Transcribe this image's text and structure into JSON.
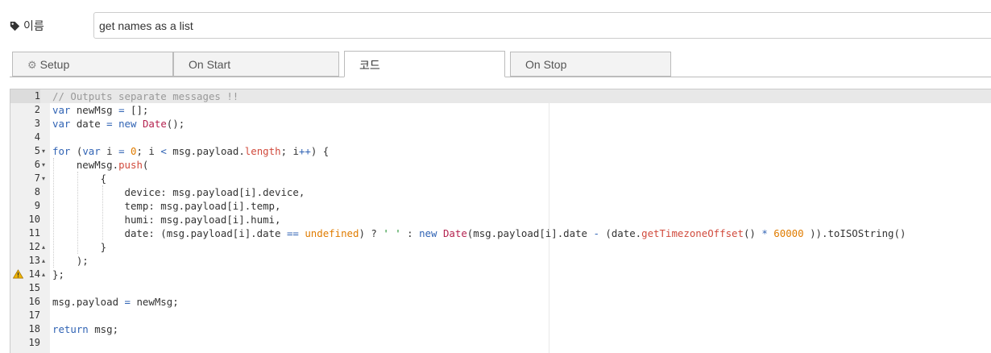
{
  "name_field": {
    "label": "이름",
    "value": "get names as a list"
  },
  "tabs": [
    {
      "label": "Setup",
      "icon": "gear-icon"
    },
    {
      "label": "On Start"
    },
    {
      "label": "코드",
      "active": true
    },
    {
      "label": "On Stop"
    }
  ],
  "editor": {
    "lines": [
      {
        "n": "1",
        "fold": "",
        "warn": false,
        "active": true
      },
      {
        "n": "2",
        "fold": "",
        "warn": false
      },
      {
        "n": "3",
        "fold": "",
        "warn": false
      },
      {
        "n": "4",
        "fold": "",
        "warn": false
      },
      {
        "n": "5",
        "fold": "▾",
        "warn": false
      },
      {
        "n": "6",
        "fold": "▾",
        "warn": false
      },
      {
        "n": "7",
        "fold": "▾",
        "warn": false
      },
      {
        "n": "8",
        "fold": "",
        "warn": false
      },
      {
        "n": "9",
        "fold": "",
        "warn": false
      },
      {
        "n": "10",
        "fold": "",
        "warn": false
      },
      {
        "n": "11",
        "fold": "",
        "warn": false
      },
      {
        "n": "12",
        "fold": "▴",
        "warn": false
      },
      {
        "n": "13",
        "fold": "▴",
        "warn": false
      },
      {
        "n": "14",
        "fold": "▴",
        "warn": true
      },
      {
        "n": "15",
        "fold": "",
        "warn": false
      },
      {
        "n": "16",
        "fold": "",
        "warn": false
      },
      {
        "n": "17",
        "fold": "",
        "warn": false
      },
      {
        "n": "18",
        "fold": "",
        "warn": false
      },
      {
        "n": "19",
        "fold": "",
        "warn": false
      }
    ],
    "code": [
      [
        [
          "cm",
          "// Outputs separate messages !!"
        ]
      ],
      [
        [
          "kw",
          "var"
        ],
        [
          "",
          "",
          " newMsg "
        ],
        [
          "op",
          "="
        ],
        [
          "",
          " [];"
        ]
      ],
      [
        [
          "kw",
          "var"
        ],
        [
          "",
          " date "
        ],
        [
          "op",
          "="
        ],
        [
          "",
          " "
        ],
        [
          "kw",
          "new"
        ],
        [
          "",
          " "
        ],
        [
          "fn",
          "Date"
        ],
        [
          "",
          "();"
        ]
      ],
      [],
      [
        [
          "kw",
          "for"
        ],
        [
          "",
          " ("
        ],
        [
          "kw",
          "var"
        ],
        [
          "",
          " i "
        ],
        [
          "op",
          "="
        ],
        [
          "",
          " "
        ],
        [
          "num",
          "0"
        ],
        [
          "",
          "; i "
        ],
        [
          "op",
          "<"
        ],
        [
          "",
          " msg.payload."
        ],
        [
          "prop",
          "length"
        ],
        [
          "",
          "; i"
        ],
        [
          "op",
          "++"
        ],
        [
          "",
          ") {"
        ]
      ],
      [
        [
          "",
          "    newMsg."
        ],
        [
          "prop",
          "push"
        ],
        [
          "",
          "("
        ]
      ],
      [
        [
          "",
          "        {"
        ]
      ],
      [
        [
          "",
          "            device: msg.payload[i].device,"
        ]
      ],
      [
        [
          "",
          "            temp: msg.payload[i].temp,"
        ]
      ],
      [
        [
          "",
          "            humi: msg.payload[i].humi,"
        ]
      ],
      [
        [
          "",
          "            date: (msg.payload[i].date "
        ],
        [
          "op",
          "=="
        ],
        [
          "",
          " "
        ],
        [
          "und",
          "undefined"
        ],
        [
          "",
          ") ? "
        ],
        [
          "str",
          "' '"
        ],
        [
          "",
          " : "
        ],
        [
          "kw",
          "new"
        ],
        [
          "",
          " "
        ],
        [
          "fn",
          "Date"
        ],
        [
          "",
          "(msg.payload[i].date "
        ],
        [
          "op",
          "-"
        ],
        [
          "",
          " (date."
        ],
        [
          "prop",
          "getTimezoneOffset"
        ],
        [
          "",
          "() "
        ],
        [
          "op",
          "*"
        ],
        [
          "",
          " "
        ],
        [
          "num",
          "60000"
        ],
        [
          "",
          " )).toISOString()"
        ]
      ],
      [
        [
          "",
          "        }"
        ]
      ],
      [
        [
          "",
          "    );"
        ]
      ],
      [
        [
          "",
          "};"
        ]
      ],
      [],
      [
        [
          "",
          "msg.payload "
        ],
        [
          "op",
          "="
        ],
        [
          "",
          " newMsg;"
        ]
      ],
      [],
      [
        [
          "kw",
          "return"
        ],
        [
          "",
          " msg;"
        ]
      ],
      []
    ]
  }
}
